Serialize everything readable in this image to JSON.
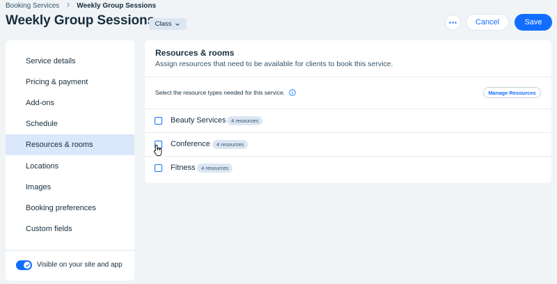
{
  "breadcrumb": {
    "parent": "Booking Services",
    "current": "Weekly Group Sessions"
  },
  "header": {
    "title": "Weekly Group Sessions",
    "badge": "Class",
    "more_icon": "more-horizontal-icon",
    "cancel_label": "Cancel",
    "save_label": "Save"
  },
  "sidebar": {
    "items": [
      {
        "label": "Service details"
      },
      {
        "label": "Pricing & payment"
      },
      {
        "label": "Add-ons"
      },
      {
        "label": "Schedule"
      },
      {
        "label": "Resources & rooms",
        "active": true
      },
      {
        "label": "Locations"
      },
      {
        "label": "Images"
      },
      {
        "label": "Booking preferences"
      },
      {
        "label": "Custom fields"
      }
    ],
    "visibility_toggle": {
      "label": "Visible on your site and app",
      "on": true
    }
  },
  "panel": {
    "title": "Resources & rooms",
    "subtitle": "Assign resources that need to be available for clients to book this service.",
    "instruction": "Select the resource types needed for this service.",
    "manage_label": "Manage Resources",
    "resources": [
      {
        "name": "Beauty Services",
        "count": "4 resources",
        "checked": false
      },
      {
        "name": "Conference",
        "count": "4 resources",
        "checked": false
      },
      {
        "name": "Fitness",
        "count": "4 resources",
        "checked": false
      }
    ]
  },
  "colors": {
    "accent": "#116dff",
    "background": "#f0f4f7",
    "active_nav": "#dbe7fa",
    "badge": "#dce6f3",
    "text": "#162d3d"
  }
}
